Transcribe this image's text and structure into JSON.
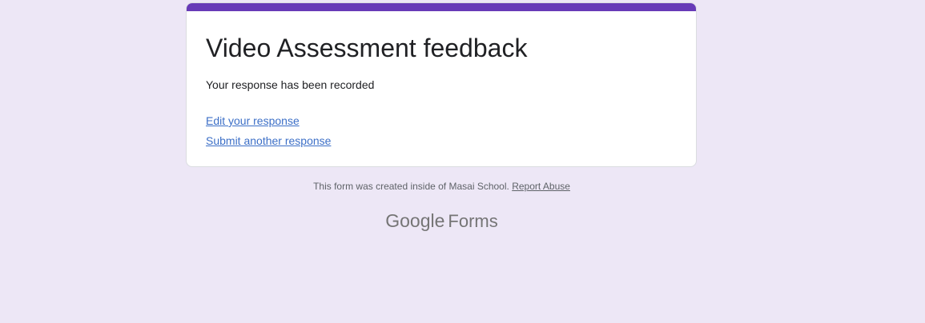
{
  "colors": {
    "background": "#ede7f6",
    "accent": "#673ab7",
    "link": "#3c6fc7",
    "card": "#ffffff"
  },
  "card": {
    "title": "Video Assessment feedback",
    "message": "Your response has been recorded",
    "links": {
      "edit": "Edit your response",
      "submit_another": "Submit another response"
    }
  },
  "footer": {
    "note": "This form was created inside of Masai School.",
    "report_abuse": "Report Abuse"
  },
  "brand": {
    "google": "Google",
    "forms": "Forms"
  }
}
